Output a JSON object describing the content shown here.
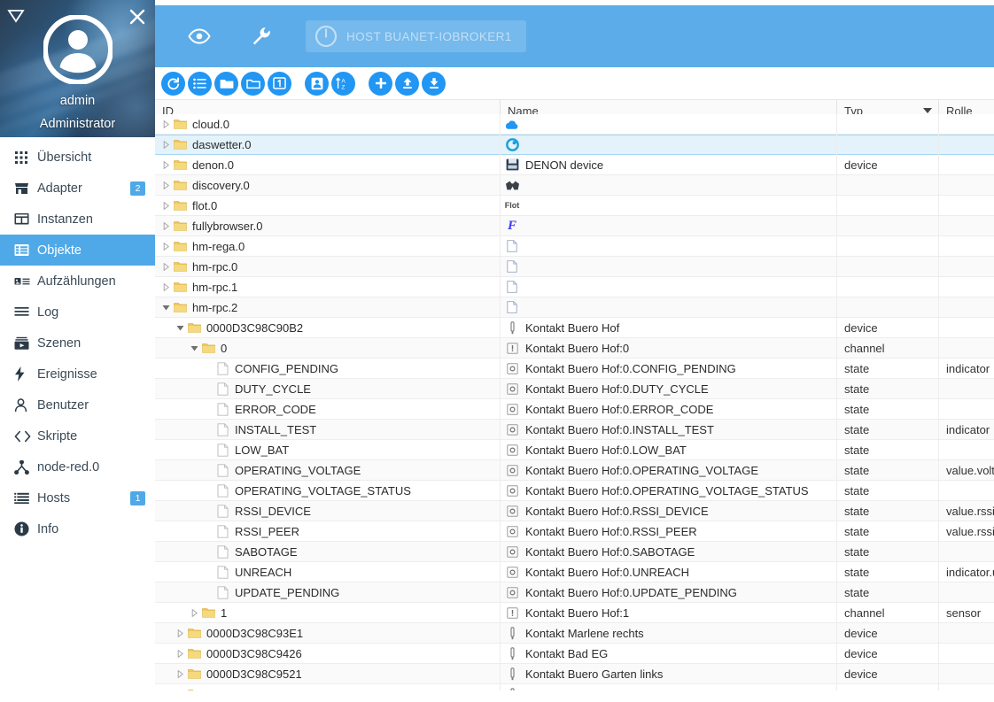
{
  "sidebar": {
    "profile": {
      "user": "admin",
      "role": "Administrator",
      "avatar_icon": "user-avatar-icon",
      "close_icon": "close-icon",
      "menu_icon": "menu-collapse-icon"
    },
    "items": [
      {
        "label": "Übersicht",
        "icon": "grid-dots-icon",
        "badge": "",
        "active": false
      },
      {
        "label": "Adapter",
        "icon": "store-icon",
        "badge": "2",
        "active": false
      },
      {
        "label": "Instanzen",
        "icon": "instances-icon",
        "badge": "",
        "active": false
      },
      {
        "label": "Objekte",
        "icon": "objects-icon",
        "badge": "",
        "active": true
      },
      {
        "label": "Aufzählungen",
        "icon": "enum-list-icon",
        "badge": "",
        "active": false
      },
      {
        "label": "Log",
        "icon": "lines-icon",
        "badge": "",
        "active": false
      },
      {
        "label": "Szenen",
        "icon": "scenes-play-icon",
        "badge": "",
        "active": false
      },
      {
        "label": "Ereignisse",
        "icon": "bolt-icon",
        "badge": "",
        "active": false
      },
      {
        "label": "Benutzer",
        "icon": "person-icon",
        "badge": "",
        "active": false
      },
      {
        "label": "Skripte",
        "icon": "code-brackets-icon",
        "badge": "",
        "active": false
      },
      {
        "label": "node-red.0",
        "icon": "node-red-icon",
        "badge": "",
        "active": false
      },
      {
        "label": "Hosts",
        "icon": "hosts-list-icon",
        "badge": "1",
        "active": false
      },
      {
        "label": "Info",
        "icon": "info-circle-icon",
        "badge": "",
        "active": false
      }
    ]
  },
  "topbar": {
    "accent_color": "#5cace9",
    "eye_icon": "eye-icon",
    "wrench_icon": "wrench-icon",
    "host_chip": {
      "icon": "power-info-icon",
      "label": "HOST BUANET-IOBROKER1"
    }
  },
  "object_toolbar": {
    "button_color": "#2196f3",
    "buttons": [
      {
        "name": "refresh-button",
        "icon": "refresh-icon",
        "glyph": "refresh"
      },
      {
        "name": "expand-all-button",
        "icon": "list-lines-icon",
        "glyph": "list"
      },
      {
        "name": "expand-folders-button",
        "icon": "folder-open-icon",
        "glyph": "folder-open"
      },
      {
        "name": "collapse-folders-button",
        "icon": "folder-closed-icon",
        "glyph": "folder-closed"
      },
      {
        "name": "expand-one-level-button",
        "icon": "number-one-icon",
        "glyph": "one"
      },
      {
        "name": "show-id-button",
        "icon": "id-card-icon",
        "glyph": "card"
      },
      {
        "name": "sort-az-button",
        "icon": "sort-az-icon",
        "glyph": "az"
      },
      {
        "name": "add-object-button",
        "icon": "plus-icon",
        "glyph": "plus"
      },
      {
        "name": "import-button",
        "icon": "upload-icon",
        "glyph": "upload"
      },
      {
        "name": "export-button",
        "icon": "download-icon",
        "glyph": "download"
      }
    ]
  },
  "grid": {
    "columns": [
      {
        "key": "id",
        "label": "ID",
        "filter": false
      },
      {
        "key": "name",
        "label": "Name",
        "filter": false
      },
      {
        "key": "typ",
        "label": "Typ",
        "filter": true
      },
      {
        "key": "rol",
        "label": "Rolle",
        "filter": false
      }
    ],
    "rows": [
      {
        "id": "cloud.0",
        "indent": 0,
        "twisty": "closed",
        "node": "folder",
        "name": "",
        "logo": "cloud",
        "typ": "",
        "rol": "",
        "selected": false,
        "clipped_top": true
      },
      {
        "id": "daswetter.0",
        "indent": 0,
        "twisty": "closed",
        "node": "folder",
        "name": "",
        "logo": "daswetter",
        "typ": "",
        "rol": "",
        "selected": true
      },
      {
        "id": "denon.0",
        "indent": 0,
        "twisty": "closed",
        "node": "folder",
        "name": "DENON device",
        "logo": "denon",
        "typ": "device",
        "rol": "",
        "selected": false
      },
      {
        "id": "discovery.0",
        "indent": 0,
        "twisty": "closed",
        "node": "folder",
        "name": "",
        "logo": "discovery",
        "typ": "",
        "rol": "",
        "selected": false
      },
      {
        "id": "flot.0",
        "indent": 0,
        "twisty": "closed",
        "node": "folder",
        "name": "",
        "logo": "flot",
        "typ": "",
        "rol": "",
        "selected": false
      },
      {
        "id": "fullybrowser.0",
        "indent": 0,
        "twisty": "closed",
        "node": "folder",
        "name": "",
        "logo": "fully",
        "typ": "",
        "rol": "",
        "selected": false
      },
      {
        "id": "hm-rega.0",
        "indent": 0,
        "twisty": "closed",
        "node": "folder",
        "name": "",
        "logo": "doc",
        "typ": "",
        "rol": "",
        "selected": false
      },
      {
        "id": "hm-rpc.0",
        "indent": 0,
        "twisty": "closed",
        "node": "folder",
        "name": "",
        "logo": "doc",
        "typ": "",
        "rol": "",
        "selected": false
      },
      {
        "id": "hm-rpc.1",
        "indent": 0,
        "twisty": "closed",
        "node": "folder",
        "name": "",
        "logo": "doc",
        "typ": "",
        "rol": "",
        "selected": false
      },
      {
        "id": "hm-rpc.2",
        "indent": 0,
        "twisty": "open",
        "node": "folder",
        "name": "",
        "logo": "doc",
        "typ": "",
        "rol": "",
        "selected": false
      },
      {
        "id": "0000D3C98C90B2",
        "indent": 1,
        "twisty": "open",
        "node": "folder",
        "name": "Kontakt Buero Hof",
        "logo": "device",
        "typ": "device",
        "rol": "",
        "selected": false
      },
      {
        "id": "0",
        "indent": 2,
        "twisty": "open",
        "node": "folder",
        "name": "Kontakt Buero Hof:0",
        "logo": "channel",
        "typ": "channel",
        "rol": "",
        "selected": false
      },
      {
        "id": "CONFIG_PENDING",
        "indent": 3,
        "twisty": "none",
        "node": "file",
        "name": "Kontakt Buero Hof:0.CONFIG_PENDING",
        "logo": "state",
        "typ": "state",
        "rol": "indicator",
        "selected": false
      },
      {
        "id": "DUTY_CYCLE",
        "indent": 3,
        "twisty": "none",
        "node": "file",
        "name": "Kontakt Buero Hof:0.DUTY_CYCLE",
        "logo": "state",
        "typ": "state",
        "rol": "",
        "selected": false
      },
      {
        "id": "ERROR_CODE",
        "indent": 3,
        "twisty": "none",
        "node": "file",
        "name": "Kontakt Buero Hof:0.ERROR_CODE",
        "logo": "state",
        "typ": "state",
        "rol": "",
        "selected": false
      },
      {
        "id": "INSTALL_TEST",
        "indent": 3,
        "twisty": "none",
        "node": "file",
        "name": "Kontakt Buero Hof:0.INSTALL_TEST",
        "logo": "state",
        "typ": "state",
        "rol": "indicator",
        "selected": false
      },
      {
        "id": "LOW_BAT",
        "indent": 3,
        "twisty": "none",
        "node": "file",
        "name": "Kontakt Buero Hof:0.LOW_BAT",
        "logo": "state",
        "typ": "state",
        "rol": "",
        "selected": false
      },
      {
        "id": "OPERATING_VOLTAGE",
        "indent": 3,
        "twisty": "none",
        "node": "file",
        "name": "Kontakt Buero Hof:0.OPERATING_VOLTAGE",
        "logo": "state",
        "typ": "state",
        "rol": "value.volta",
        "selected": false
      },
      {
        "id": "OPERATING_VOLTAGE_STATUS",
        "indent": 3,
        "twisty": "none",
        "node": "file",
        "name": "Kontakt Buero Hof:0.OPERATING_VOLTAGE_STATUS",
        "logo": "state",
        "typ": "state",
        "rol": "",
        "selected": false
      },
      {
        "id": "RSSI_DEVICE",
        "indent": 3,
        "twisty": "none",
        "node": "file",
        "name": "Kontakt Buero Hof:0.RSSI_DEVICE",
        "logo": "state",
        "typ": "state",
        "rol": "value.rssi",
        "selected": false
      },
      {
        "id": "RSSI_PEER",
        "indent": 3,
        "twisty": "none",
        "node": "file",
        "name": "Kontakt Buero Hof:0.RSSI_PEER",
        "logo": "state",
        "typ": "state",
        "rol": "value.rssi",
        "selected": false
      },
      {
        "id": "SABOTAGE",
        "indent": 3,
        "twisty": "none",
        "node": "file",
        "name": "Kontakt Buero Hof:0.SABOTAGE",
        "logo": "state",
        "typ": "state",
        "rol": "",
        "selected": false
      },
      {
        "id": "UNREACH",
        "indent": 3,
        "twisty": "none",
        "node": "file",
        "name": "Kontakt Buero Hof:0.UNREACH",
        "logo": "state",
        "typ": "state",
        "rol": "indicator.u",
        "selected": false
      },
      {
        "id": "UPDATE_PENDING",
        "indent": 3,
        "twisty": "none",
        "node": "file",
        "name": "Kontakt Buero Hof:0.UPDATE_PENDING",
        "logo": "state",
        "typ": "state",
        "rol": "",
        "selected": false
      },
      {
        "id": "1",
        "indent": 2,
        "twisty": "closed",
        "node": "folder",
        "name": "Kontakt Buero Hof:1",
        "logo": "channel",
        "typ": "channel",
        "rol": "sensor",
        "selected": false
      },
      {
        "id": "0000D3C98C93E1",
        "indent": 1,
        "twisty": "closed",
        "node": "folder",
        "name": "Kontakt Marlene rechts",
        "logo": "device",
        "typ": "device",
        "rol": "",
        "selected": false
      },
      {
        "id": "0000D3C98C9426",
        "indent": 1,
        "twisty": "closed",
        "node": "folder",
        "name": "Kontakt Bad EG",
        "logo": "device",
        "typ": "device",
        "rol": "",
        "selected": false
      },
      {
        "id": "0000D3C98C9521",
        "indent": 1,
        "twisty": "closed",
        "node": "folder",
        "name": "Kontakt Buero Garten links",
        "logo": "device",
        "typ": "device",
        "rol": "",
        "selected": false
      },
      {
        "id": "",
        "indent": 1,
        "twisty": "closed",
        "node": "folder",
        "name": "",
        "logo": "device",
        "typ": "",
        "rol": "",
        "selected": false,
        "clipped_bottom": true
      }
    ]
  }
}
